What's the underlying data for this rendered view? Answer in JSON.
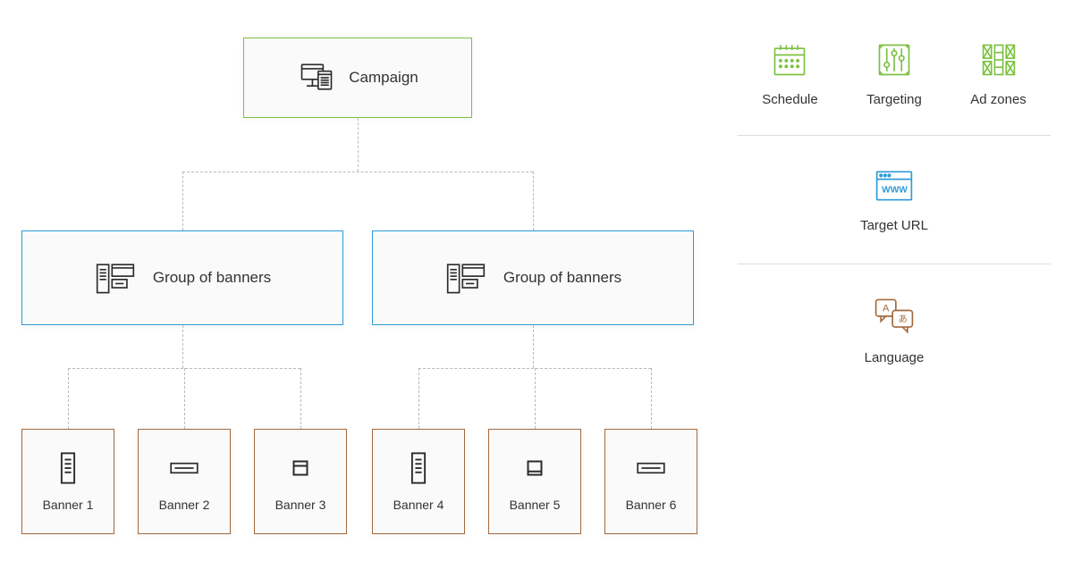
{
  "hierarchy": {
    "campaign": {
      "label": "Campaign"
    },
    "groups": {
      "a": {
        "label": "Group of banners"
      },
      "b": {
        "label": "Group of banners"
      }
    },
    "banners": {
      "b1": "Banner 1",
      "b2": "Banner 2",
      "b3": "Banner 3",
      "b4": "Banner 4",
      "b5": "Banner 5",
      "b6": "Banner 6"
    }
  },
  "sidebar": {
    "row1": {
      "schedule": "Schedule",
      "targeting": "Targeting",
      "adzones": "Ad zones"
    },
    "row2": {
      "target_url": "Target URL"
    },
    "row3": {
      "language": "Language"
    }
  },
  "colors": {
    "green": "#7cc142",
    "blue": "#2e9bd6",
    "brown": "#a36a3e",
    "icon_dark": "#2b2b2b"
  }
}
